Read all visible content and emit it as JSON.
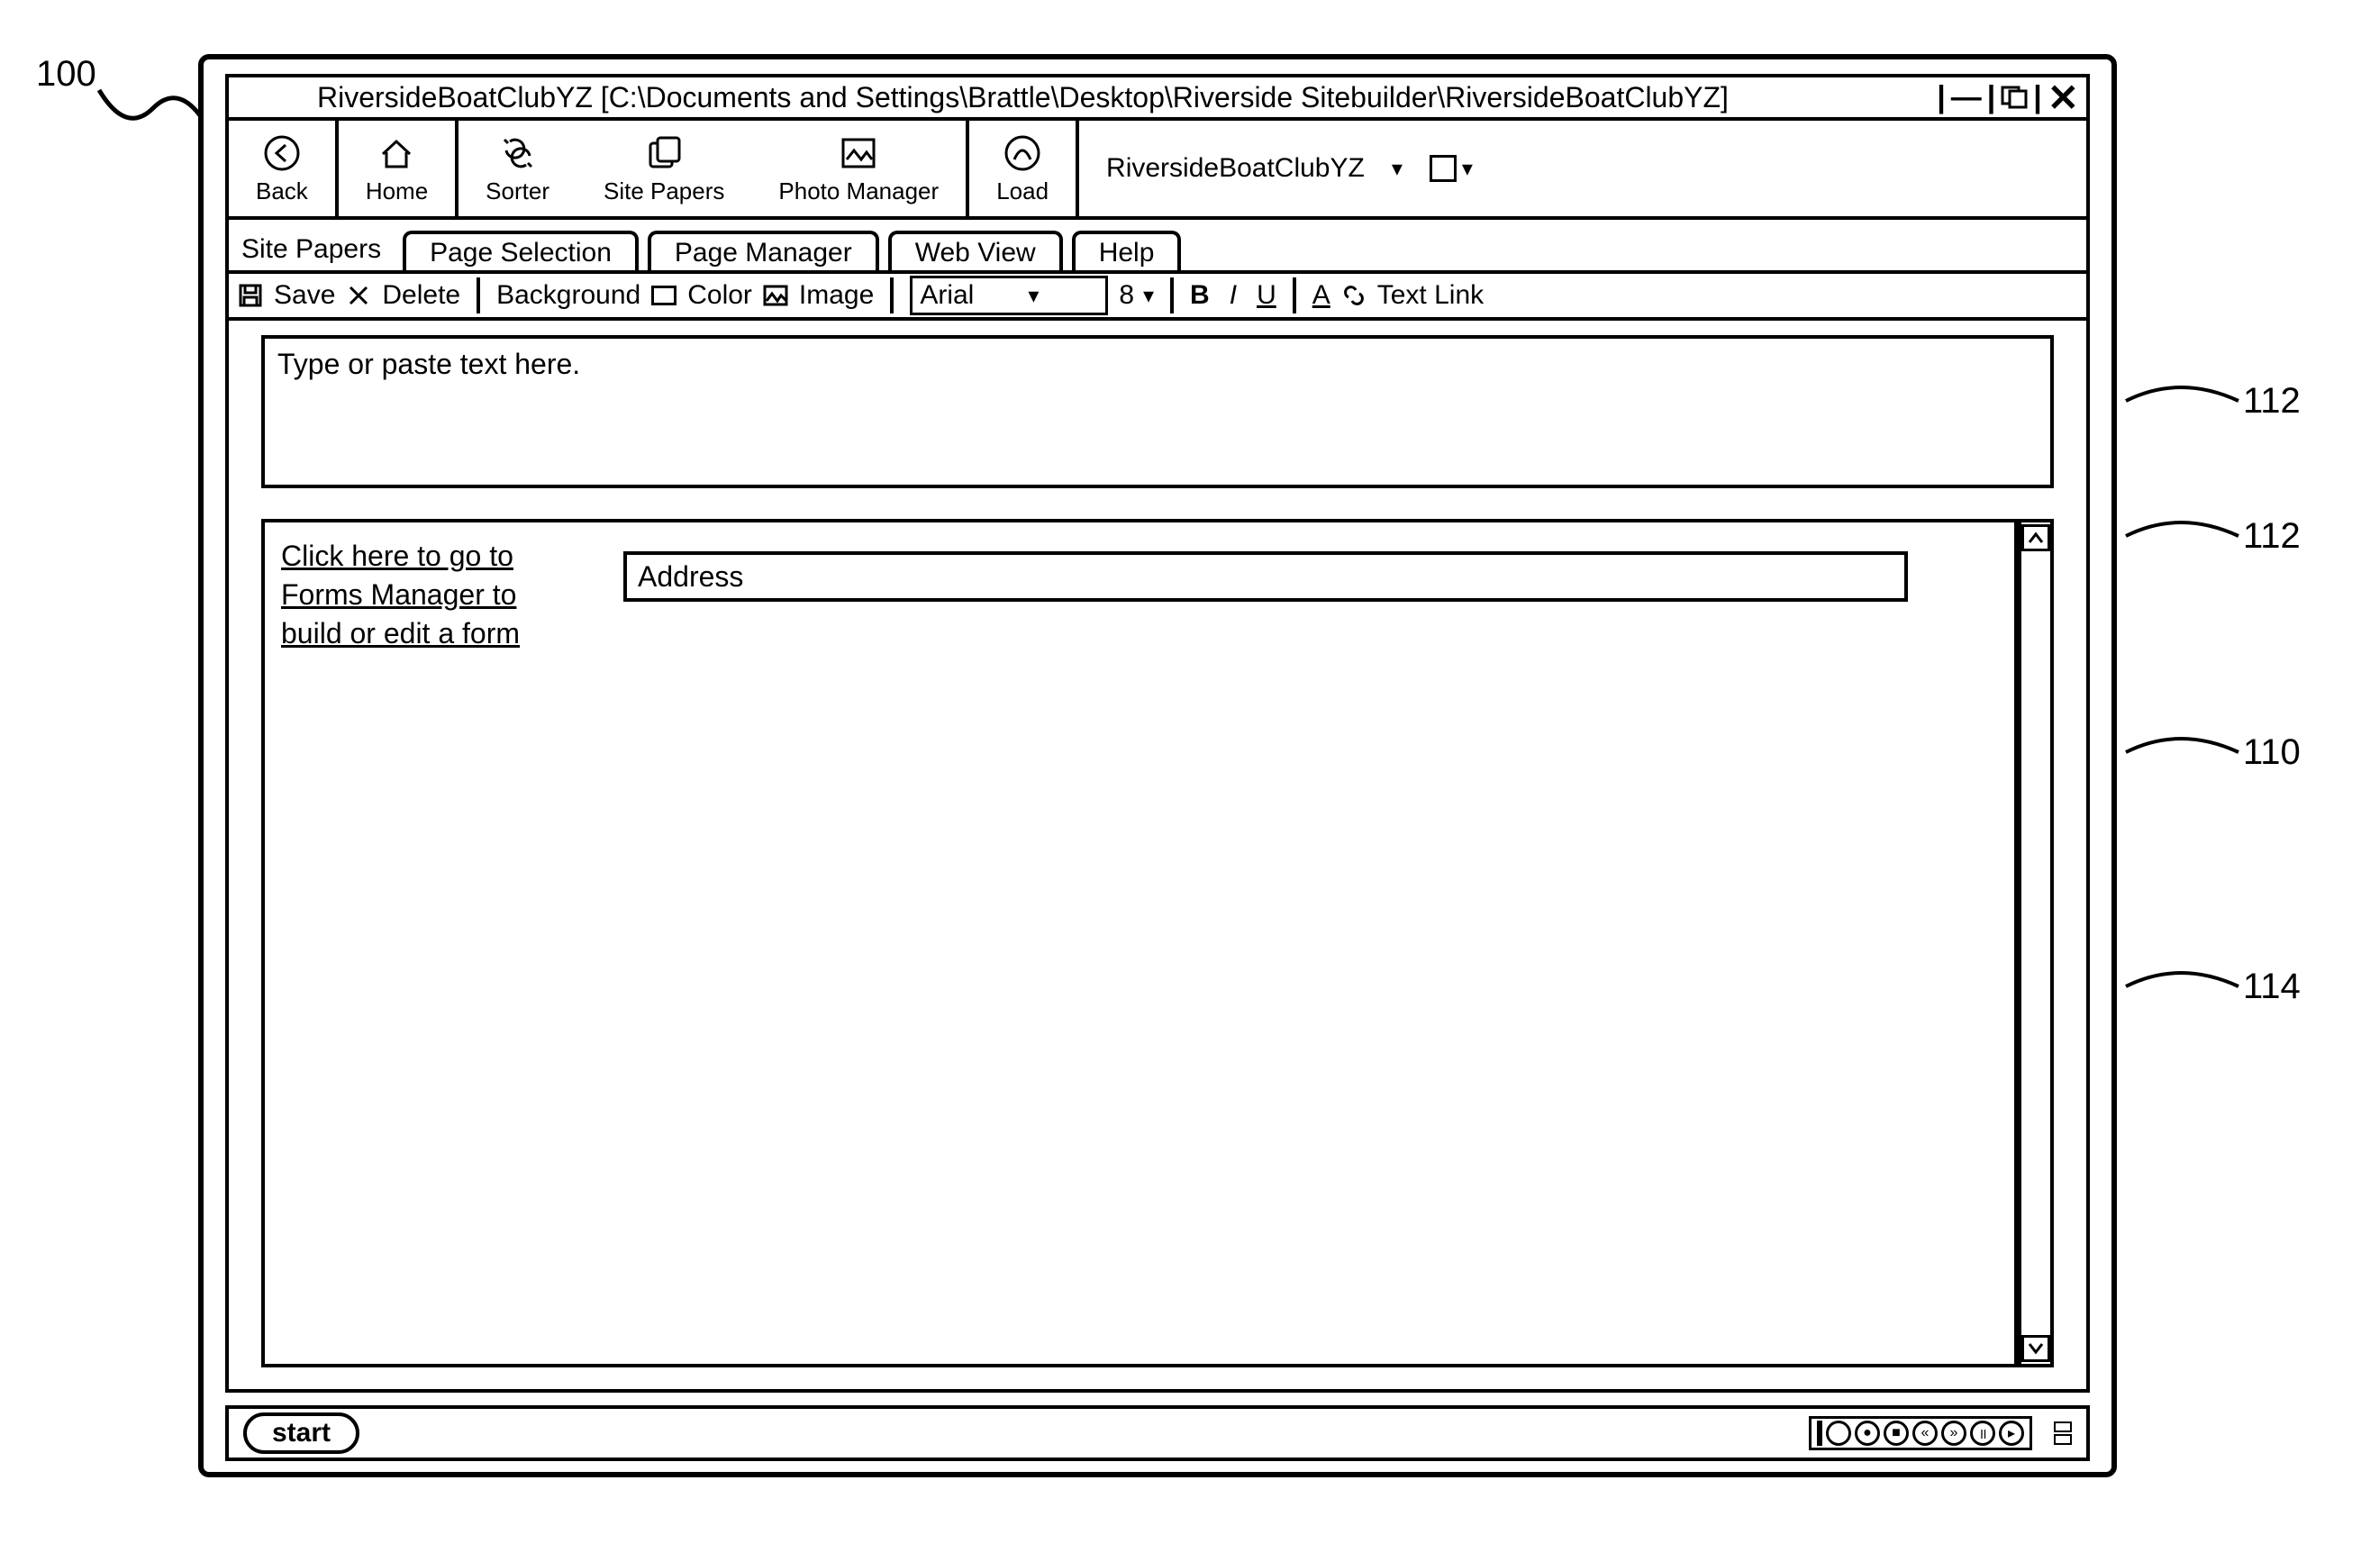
{
  "figure": {
    "ref_main": "100",
    "callouts": [
      "112",
      "112",
      "110",
      "114"
    ]
  },
  "titlebar": {
    "text": "RiversideBoatClubYZ [C:\\Documents and Settings\\Brattle\\Desktop\\Riverside Sitebuilder\\RiversideBoatClubYZ]"
  },
  "toolbar": {
    "back": "Back",
    "home": "Home",
    "sorter": "Sorter",
    "site_papers": "Site Papers",
    "photo_manager": "Photo Manager",
    "load": "Load",
    "project_name": "RiversideBoatClubYZ"
  },
  "tabs": {
    "section_label": "Site Papers",
    "items": [
      "Page Selection",
      "Page Manager",
      "Web View",
      "Help"
    ]
  },
  "format": {
    "save": "Save",
    "delete": "Delete",
    "background": "Background",
    "color": "Color",
    "image": "Image",
    "font_name": "Arial",
    "font_size": "8",
    "bold": "B",
    "italic": "I",
    "underline": "U",
    "text_link": "Text Link"
  },
  "content": {
    "text_placeholder": "Type or paste text here.",
    "forms_link": "Click here to go to Forms Manager to build or edit a form",
    "address_label": "Address"
  },
  "taskbar": {
    "start": "start"
  }
}
